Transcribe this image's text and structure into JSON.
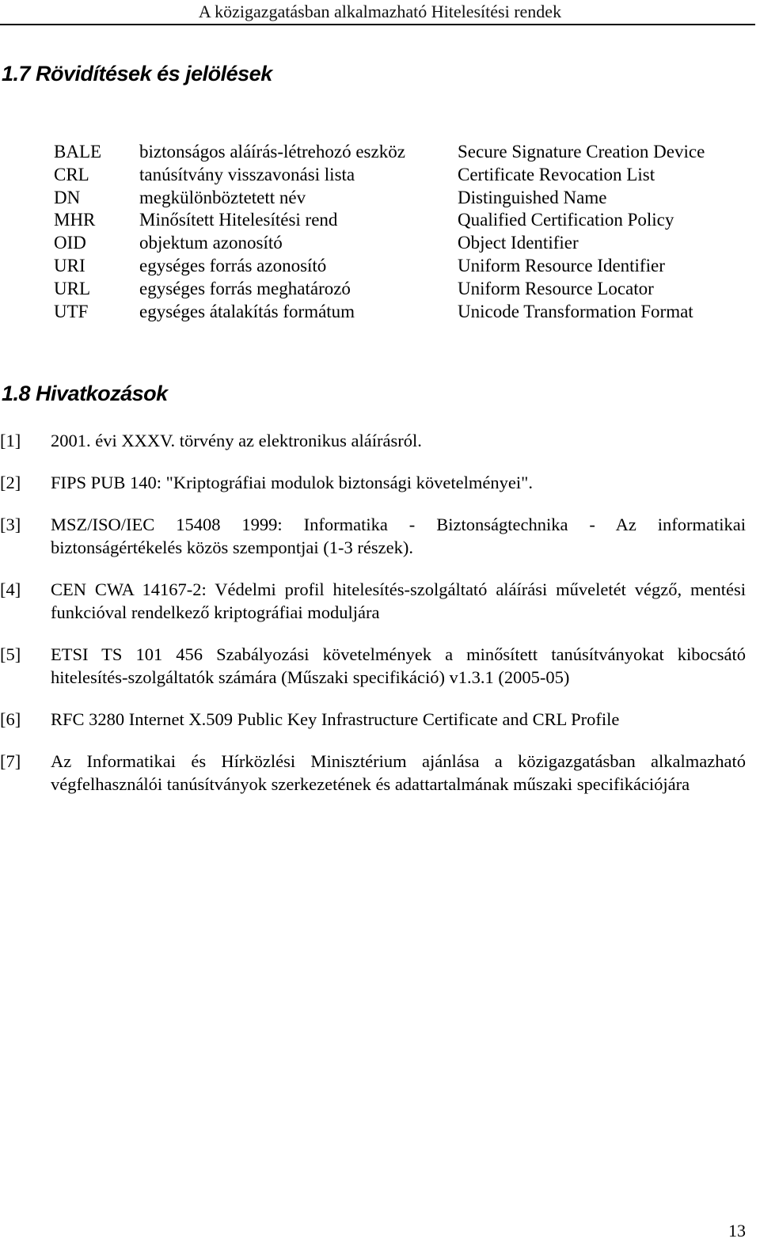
{
  "running_header": "A közigazgatásban alkalmazható Hitelesítési rendek",
  "sections": {
    "abbreviations": {
      "heading": "1.7 Rövidítések és jelölések",
      "rows": [
        {
          "code": "BALE",
          "hu": "biztonságos aláírás-létrehozó eszköz",
          "en": "Secure Signature Creation Device"
        },
        {
          "code": "CRL",
          "hu": "tanúsítvány visszavonási lista",
          "en": "Certificate Revocation List"
        },
        {
          "code": "DN",
          "hu": "megkülönböztetett név",
          "en": "Distinguished Name"
        },
        {
          "code": "MHR",
          "hu": "Minősített Hitelesítési rend",
          "en": "Qualified Certification Policy"
        },
        {
          "code": "OID",
          "hu": "objektum azonosító",
          "en": "Object Identifier"
        },
        {
          "code": "URI",
          "hu": "egységes forrás azonosító",
          "en": "Uniform Resource Identifier"
        },
        {
          "code": "URL",
          "hu": "egységes forrás meghatározó",
          "en": "Uniform Resource Locator"
        },
        {
          "code": "UTF",
          "hu": "egységes átalakítás formátum",
          "en": "Unicode Transformation Format"
        }
      ]
    },
    "references": {
      "heading": "1.8 Hivatkozások",
      "items": [
        {
          "num": "[1]",
          "text": "2001. évi XXXV. törvény az elektronikus aláírásról."
        },
        {
          "num": "[2]",
          "text": "FIPS PUB 140: \"Kriptográfiai modulok biztonsági követelményei\"."
        },
        {
          "num": "[3]",
          "text": "MSZ/ISO/IEC 15408 1999: Informatika - Biztonságtechnika - Az informatikai biztonságértékelés közös szempontjai (1-3 részek)."
        },
        {
          "num": "[4]",
          "text": "CEN CWA 14167-2: Védelmi profil hitelesítés-szolgáltató aláírási műveletét végző, mentési funkcióval rendelkező kriptográfiai moduljára"
        },
        {
          "num": "[5]",
          "text": "ETSI TS 101 456 Szabályozási követelmények a minősített tanúsítványokat kibocsátó hitelesítés-szolgáltatók számára (Műszaki specifikáció) v1.3.1 (2005-05)"
        },
        {
          "num": "[6]",
          "text": "RFC 3280 Internet X.509 Public Key Infrastructure Certificate and CRL Profile"
        },
        {
          "num": "[7]",
          "text": "Az Informatikai és Hírközlési Minisztérium ajánlása a közigazgatásban alkalmazható végfelhasználói tanúsítványok szerkezetének és adattartalmának műszaki specifikációjára"
        }
      ]
    }
  },
  "page_number": "13"
}
